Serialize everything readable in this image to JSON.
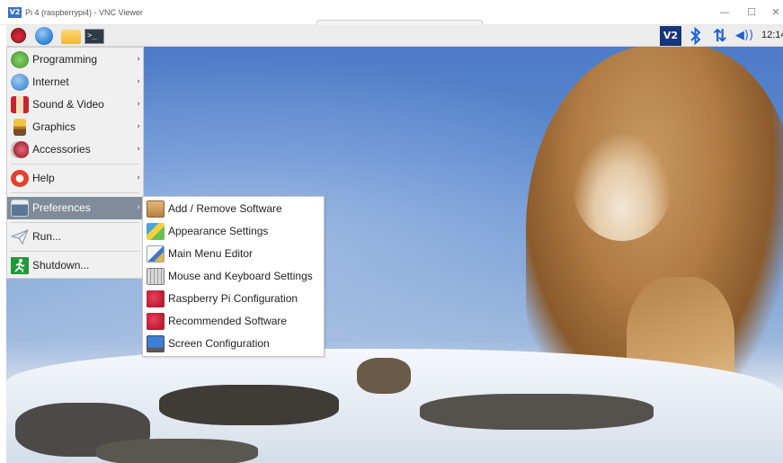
{
  "window": {
    "title": "Pi 4 (raspberrypi4) - VNC Viewer",
    "logo_text": "V2",
    "minimize": "—",
    "maximize": "☐",
    "close": "✕"
  },
  "panel": {
    "terminal_glyph": ">_",
    "tray_vnc_text": "V2",
    "bluetooth_glyph": "∦",
    "network_glyph": "⇅",
    "volume_glyph": "◀))",
    "clock": "12:14"
  },
  "menu": {
    "arrow": "›",
    "items": [
      {
        "label": "Programming",
        "icon": "programming-icon",
        "has_submenu": true
      },
      {
        "label": "Internet",
        "icon": "internet-icon",
        "has_submenu": true
      },
      {
        "label": "Sound & Video",
        "icon": "sound-video-icon",
        "has_submenu": true
      },
      {
        "label": "Graphics",
        "icon": "graphics-icon",
        "has_submenu": true
      },
      {
        "label": "Accessories",
        "icon": "accessories-icon",
        "has_submenu": true
      },
      {
        "label": "Help",
        "icon": "help-icon",
        "has_submenu": true
      },
      {
        "label": "Preferences",
        "icon": "preferences-icon",
        "has_submenu": true,
        "active": true
      },
      {
        "label": "Run...",
        "icon": "run-icon",
        "has_submenu": false
      },
      {
        "label": "Shutdown...",
        "icon": "shutdown-icon",
        "has_submenu": false
      }
    ]
  },
  "submenu": {
    "items": [
      {
        "label": "Add / Remove Software",
        "icon": "package-icon"
      },
      {
        "label": "Appearance Settings",
        "icon": "appearance-icon"
      },
      {
        "label": "Main Menu Editor",
        "icon": "menu-editor-icon"
      },
      {
        "label": "Mouse and Keyboard Settings",
        "icon": "keyboard-icon"
      },
      {
        "label": "Raspberry Pi Configuration",
        "icon": "raspberry-icon"
      },
      {
        "label": "Recommended Software",
        "icon": "raspberry-icon"
      },
      {
        "label": "Screen Configuration",
        "icon": "monitor-icon"
      }
    ]
  },
  "colors": {
    "menu_active": "#808c99",
    "tray_blue": "#1d60d8"
  }
}
